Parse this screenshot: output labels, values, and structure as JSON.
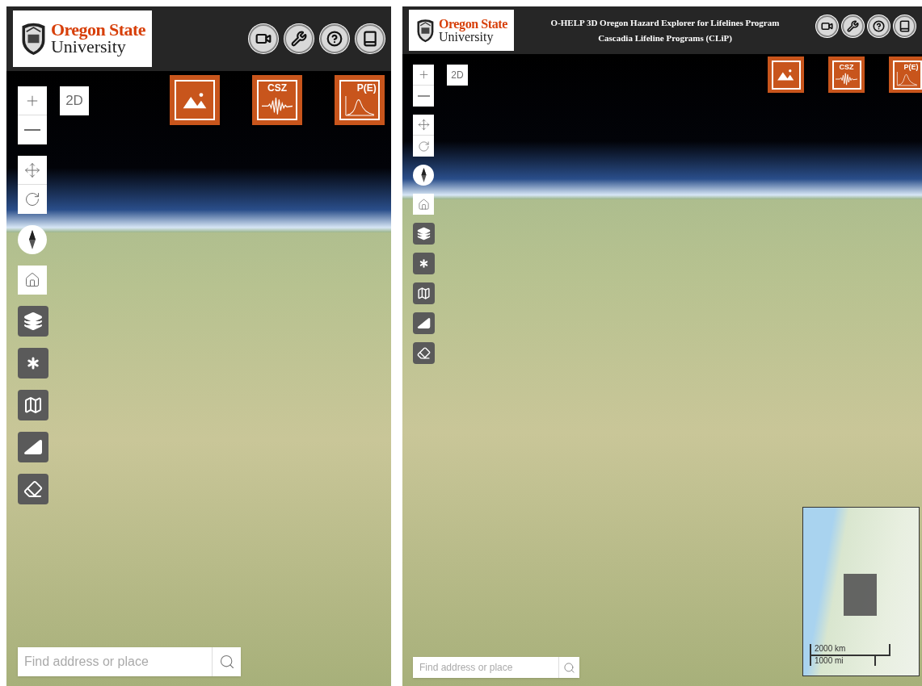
{
  "panels": [
    {
      "kind": "full",
      "logo": {
        "line1": "Oregon State",
        "line2": "University"
      },
      "header_buttons": [
        {
          "kind": "video"
        },
        {
          "kind": "tools"
        },
        {
          "kind": "help"
        },
        {
          "kind": "book"
        }
      ],
      "view_toggle": "2D",
      "tool_tiles": [
        {
          "kind": "images"
        },
        {
          "kind": "wave",
          "label": "CSZ"
        },
        {
          "kind": "curve",
          "label": "P(E)"
        }
      ],
      "search": {
        "placeholder": "Find address or place"
      }
    },
    {
      "kind": "compact",
      "logo": {
        "line1": "Oregon State",
        "line2": "University"
      },
      "title_lines": [
        "O-HELP 3D Oregon Hazard Explorer for Lifelines Program",
        "Cascadia Lifeline Programs (CLiP)"
      ],
      "header_buttons": [
        {
          "kind": "video"
        },
        {
          "kind": "tools"
        },
        {
          "kind": "help"
        },
        {
          "kind": "book"
        }
      ],
      "view_toggle": "2D",
      "tool_tiles": [
        {
          "kind": "images"
        },
        {
          "kind": "wave",
          "label": "CSZ"
        },
        {
          "kind": "curve",
          "label": "P(E)"
        }
      ],
      "search": {
        "placeholder": "Find address or place"
      },
      "overview_map": {
        "scale_labels": [
          "2000 km",
          "1000 mi"
        ]
      }
    }
  ]
}
